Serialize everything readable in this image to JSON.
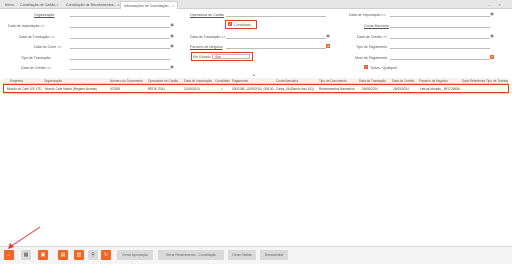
{
  "tabs": {
    "menu": "Menu",
    "t1": "Conciliação de Cartão",
    "t2": "Conciliação de Recebimentos...",
    "t3": "Informações de Conciliação..."
  },
  "filters": {
    "organizacao": "Organização",
    "operadora": "Operadora de Cartão",
    "data_importacao_ge": "Data de Importação >=",
    "data_importacao_le": "Data de Importação <=",
    "conciliado": "Conciliado",
    "conta_bancaria": "Conta Bancária",
    "data_transacao_ge": "Data de Transação >=",
    "data_transacao_le": "Data de Transação <=",
    "data_credito_ge": "Data de Crédito >=",
    "data_corte_ge": "Data do Corte >=",
    "parceiro_negocio": "Parceiro de Negócio",
    "tipo_pagamento": "Tipo de Pagamento",
    "tipo_transacao": "Tipo de Transação",
    "em_estado": "Em Estado",
    "em_estado_value": "Sim",
    "meio_pagamento": "Meio de Pagamento",
    "data_credito_le": "Data de Crédito <=",
    "todos_qualquer": "Todos / Qualquer"
  },
  "grid": {
    "headers": [
      "Empresa",
      "Organização",
      "Número do Documento",
      "Operadora de Cartão",
      "Data de Importação",
      "Conciliado",
      "Pagamento",
      "Conta Bancária",
      "Tipo de Documento",
      "Data da Transação",
      "Data do Crédito",
      "Parceiro de Negócio",
      "Data Referência",
      "Tipo de Transação"
    ],
    "row": [
      "Mundo do Café S/S LTD",
      "Mundo Café Matriz (Regime Normal)",
      "972651",
      "REDE ITAU",
      "11/09/2024",
      "✓",
      "0000188_11/09/2024_008.00...",
      "Caixa_06 (Banco Itaú 341)",
      "Recebimentos Bancários",
      "26/08/2024",
      "26/09/2024",
      "Letícia Mourão_ 891725656...",
      "",
      ""
    ]
  },
  "bottom": {
    "btn_aprovar": "Gerar Aprovação",
    "btn_recebimento": "Gerar Recebimento - Conciliação",
    "btn_tarifas": "Gerar Tarifas",
    "btn_desconciliar": "Desconciliar"
  }
}
